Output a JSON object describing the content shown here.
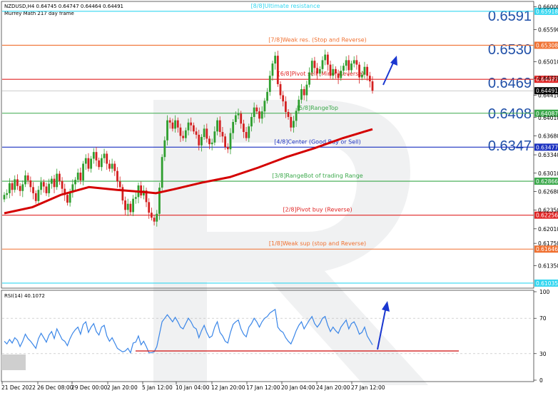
{
  "header": {
    "symbol_line": "NZDUSD,H4  0.64745 0.64747 0.64464 0.64491",
    "indicator_line": "Murrey Math 217 day frame"
  },
  "rsi_header": "RSI(14) 40.1072",
  "colors": {
    "bull_candle": "#2e9e2e",
    "bear_candle": "#d32020",
    "ma_line": "#d40000",
    "rsi_line": "#3a86e8",
    "arrow": "#1a37d0",
    "big_label": "#1f4fa8"
  },
  "big_labels": [
    "0.6591",
    "0.6530",
    "0.6469",
    "0.6408",
    "0.6347"
  ],
  "chart_data": [
    {
      "type": "candlestick",
      "title": "NZDUSD,H4",
      "ylim": [
        0.6097,
        0.6607
      ],
      "y_ticks": [
        "0.66000",
        "0.65590",
        "0.65010",
        "0.64720",
        "0.64410",
        "0.64010",
        "0.63680",
        "0.63340",
        "0.63010",
        "0.62680",
        "0.62350",
        "0.62010",
        "0.61750",
        "0.61350"
      ],
      "x_labels": [
        "21 Dec 2022",
        "26 Dec 08:00",
        "29 Dec 00:00",
        "2 Jan 20:00",
        "5 Jan 12:00",
        "10 Jan 04:00",
        "12 Jan 20:00",
        "17 Jan 12:00",
        "20 Jan 04:00",
        "24 Jan 20:00",
        "27 Jan 12:00"
      ],
      "murrey_levels": [
        {
          "value": 0.65918,
          "price": "0.65918",
          "label": "[8/8]Ultimate resistance",
          "color": "#33d6f0"
        },
        {
          "value": 0.65308,
          "price": "0.65308",
          "label": "[7/8]Weak res. (Stop and Reverse)",
          "color": "#f07030"
        },
        {
          "value": 0.64697,
          "price": "0.64697",
          "label": "[6/8]Pivot sell (Minor Reverse)",
          "color": "#e02424"
        },
        {
          "value": 0.64087,
          "price": "0.64087",
          "label": "[5/8]RangeTop",
          "color": "#3aa84a"
        },
        {
          "value": 0.63477,
          "price": "0.63477",
          "label": "[4/8]Center (Good Buy or Sell)",
          "color": "#1a30c0"
        },
        {
          "value": 0.62866,
          "price": "0.62866",
          "label": "[3/8]RangeBot of trading Range",
          "color": "#3aa84a"
        },
        {
          "value": 0.62256,
          "price": "0.62256",
          "label": "[2/8]Pivot buy (Reverse)",
          "color": "#e02424"
        },
        {
          "value": 0.61646,
          "price": "0.61646",
          "label": "[1/8]Weak sup (stop and Reverse)",
          "color": "#f07030"
        },
        {
          "value": 0.61035,
          "price": "0.61035",
          "label": "",
          "color": "#33d6f0"
        }
      ],
      "current_price": "0.64491",
      "current_price_value": 0.64491,
      "close": [
        0.6262,
        0.6265,
        0.6283,
        0.6271,
        0.629,
        0.6278,
        0.6269,
        0.6281,
        0.6297,
        0.6288,
        0.6276,
        0.6265,
        0.6251,
        0.6271,
        0.6285,
        0.6277,
        0.6265,
        0.6282,
        0.6291,
        0.6276,
        0.63,
        0.6287,
        0.6273,
        0.6262,
        0.6248,
        0.6266,
        0.6281,
        0.6289,
        0.6302,
        0.6288,
        0.6318,
        0.6328,
        0.6309,
        0.6327,
        0.6339,
        0.6324,
        0.6312,
        0.6328,
        0.6336,
        0.6318,
        0.6309,
        0.6318,
        0.6305,
        0.6286,
        0.6276,
        0.6252,
        0.6235,
        0.6246,
        0.6231,
        0.6255,
        0.6258,
        0.6279,
        0.6261,
        0.627,
        0.6249,
        0.623,
        0.6221,
        0.6214,
        0.6228,
        0.6275,
        0.633,
        0.636,
        0.6396,
        0.6392,
        0.6381,
        0.6396,
        0.6383,
        0.6368,
        0.6364,
        0.6378,
        0.6392,
        0.6387,
        0.6376,
        0.637,
        0.6351,
        0.6366,
        0.6381,
        0.6363,
        0.6353,
        0.6356,
        0.6376,
        0.6396,
        0.6375,
        0.6367,
        0.6348,
        0.6344,
        0.6373,
        0.6393,
        0.6405,
        0.6408,
        0.639,
        0.6375,
        0.6364,
        0.6385,
        0.6402,
        0.6419,
        0.6412,
        0.6399,
        0.6412,
        0.6431,
        0.6447,
        0.6476,
        0.6498,
        0.6512,
        0.6461,
        0.6441,
        0.643,
        0.6411,
        0.6402,
        0.6383,
        0.6395,
        0.6413,
        0.6433,
        0.6452,
        0.6441,
        0.646,
        0.6482,
        0.6503,
        0.649,
        0.648,
        0.6488,
        0.6504,
        0.6514,
        0.6496,
        0.6476,
        0.6488,
        0.648,
        0.6472,
        0.6485,
        0.6494,
        0.6504,
        0.6486,
        0.6498,
        0.6504,
        0.6496,
        0.6473,
        0.6478,
        0.6492,
        0.6476,
        0.6466,
        0.6449
      ],
      "ma217": [
        [
          0,
          0.6229
        ],
        [
          40,
          0.624
        ],
        [
          80,
          0.6262
        ],
        [
          120,
          0.6276
        ],
        [
          160,
          0.6271
        ],
        [
          200,
          0.6267
        ],
        [
          215,
          0.6265
        ],
        [
          240,
          0.6272
        ],
        [
          280,
          0.6284
        ],
        [
          320,
          0.6294
        ],
        [
          360,
          0.6311
        ],
        [
          400,
          0.633
        ],
        [
          440,
          0.6346
        ],
        [
          480,
          0.6364
        ],
        [
          522,
          0.638
        ]
      ]
    },
    {
      "type": "line",
      "title": "RSI(14) 40.1072",
      "ylim": [
        0,
        100
      ],
      "y_ticks": [
        100,
        70,
        30,
        0
      ],
      "x": "same candles as price chart",
      "rsi": [
        44,
        41,
        46,
        42,
        48,
        45,
        38,
        44,
        52,
        47,
        44,
        40,
        36,
        47,
        53,
        48,
        43,
        51,
        55,
        47,
        58,
        52,
        46,
        44,
        39,
        47,
        53,
        57,
        60,
        52,
        63,
        66,
        54,
        60,
        64,
        55,
        51,
        60,
        62,
        50,
        44,
        48,
        42,
        36,
        34,
        32,
        33,
        36,
        31,
        42,
        43,
        50,
        40,
        44,
        38,
        31,
        31,
        32,
        38,
        52,
        66,
        70,
        74,
        70,
        66,
        71,
        66,
        60,
        58,
        64,
        70,
        66,
        60,
        58,
        48,
        56,
        62,
        54,
        48,
        50,
        60,
        66,
        54,
        50,
        44,
        42,
        54,
        63,
        66,
        68,
        58,
        52,
        49,
        60,
        64,
        70,
        66,
        60,
        66,
        70,
        72,
        76,
        78,
        80,
        60,
        56,
        54,
        48,
        44,
        41,
        48,
        56,
        62,
        66,
        58,
        63,
        68,
        72,
        64,
        60,
        64,
        70,
        72,
        62,
        55,
        60,
        56,
        53,
        60,
        64,
        68,
        58,
        64,
        66,
        60,
        52,
        54,
        60,
        50,
        45,
        40
      ],
      "support_line": 33
    }
  ]
}
